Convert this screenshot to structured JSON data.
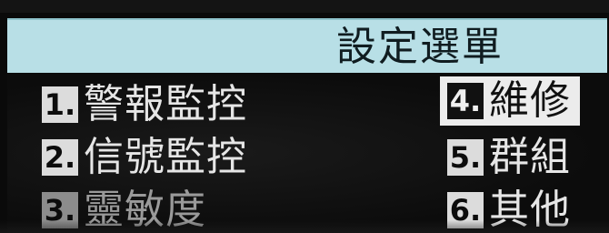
{
  "title": "設定選單",
  "menu": {
    "items": [
      {
        "number": "1.",
        "label": "警報監控",
        "selected": false
      },
      {
        "number": "2.",
        "label": "信號監控",
        "selected": false
      },
      {
        "number": "3.",
        "label": "靈敏度",
        "selected": false
      },
      {
        "number": "4.",
        "label": "維修",
        "selected": true
      },
      {
        "number": "5.",
        "label": "群組",
        "selected": false
      },
      {
        "number": "6.",
        "label": "其他",
        "selected": false
      }
    ]
  },
  "colors": {
    "title_bar": "#b8dfe6",
    "screen_bg": "#0a0a0a",
    "text": "#e6e6e6",
    "highlight": "#ececec"
  }
}
